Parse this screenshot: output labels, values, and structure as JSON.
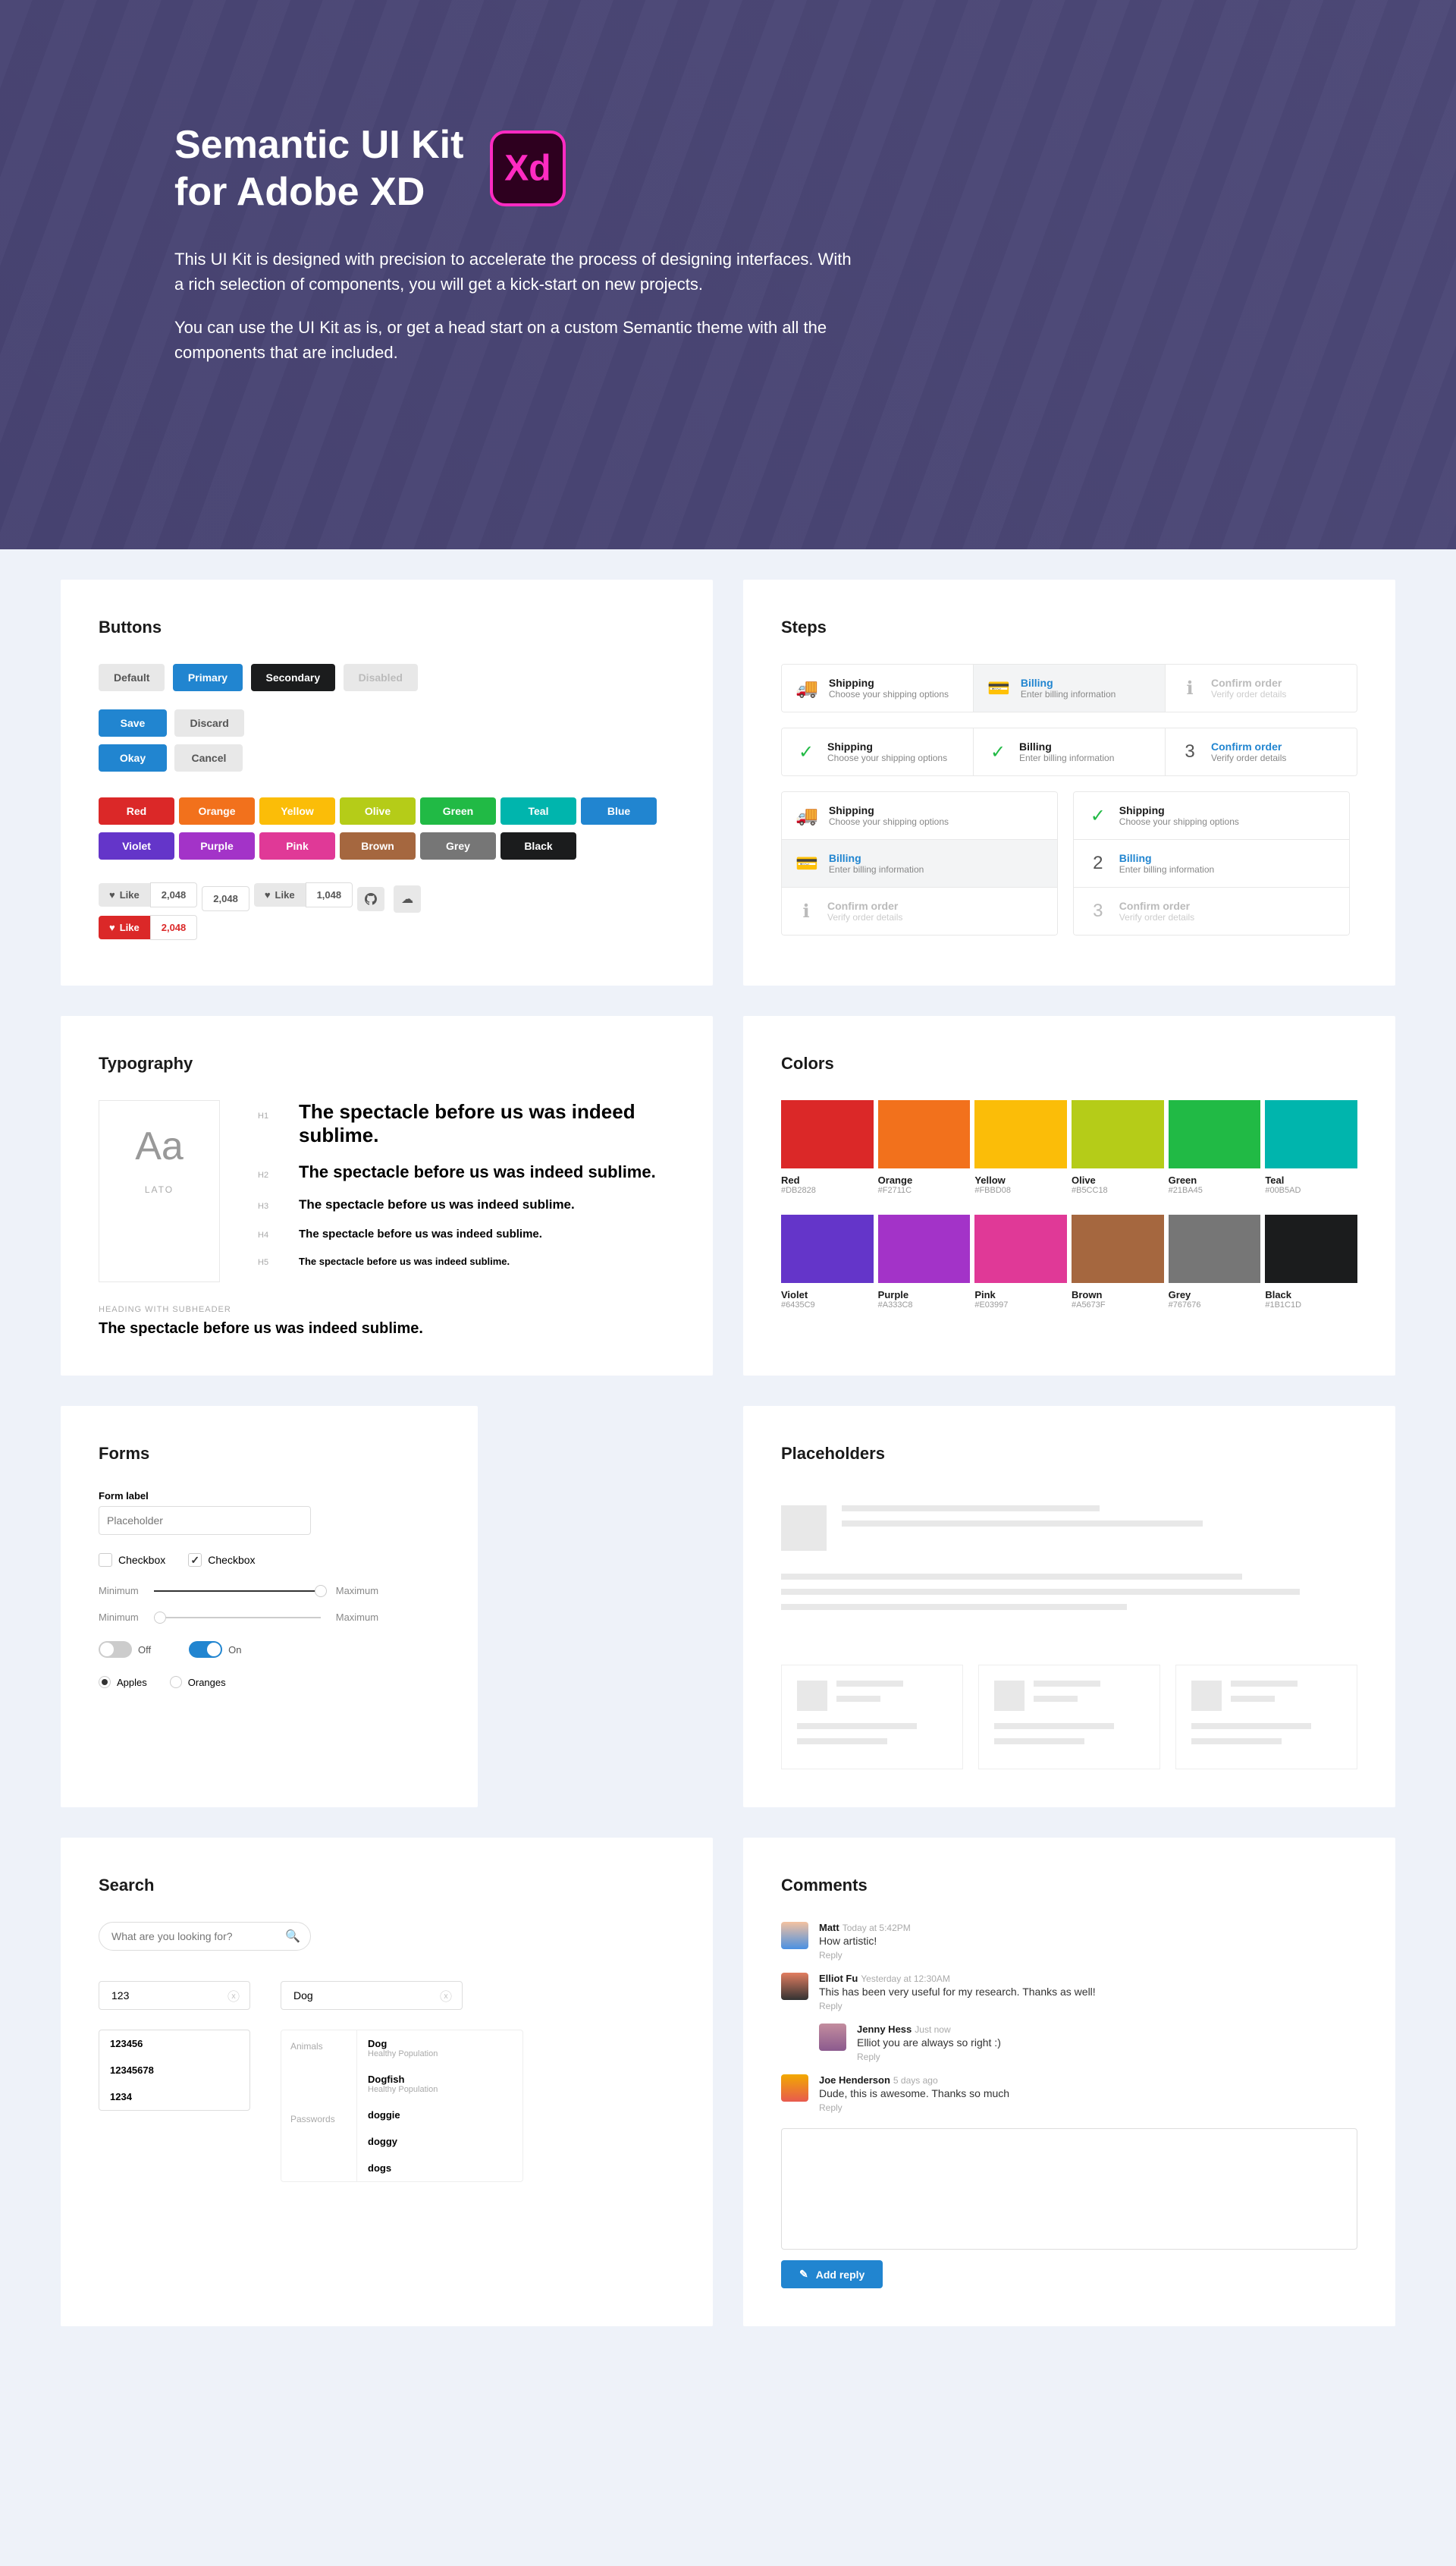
{
  "hero": {
    "title_line1": "Semantic UI Kit",
    "title_line2": "for Adobe XD",
    "para1": "This UI Kit is designed with precision to accelerate the process of designing interfaces. With a rich selection of components, you will get a kick-start on new projects.",
    "para2": "You can use the UI Kit as is, or get a head start on a custom Semantic theme with all the components that are included."
  },
  "sections": {
    "buttons": "Buttons",
    "steps": "Steps",
    "typography": "Typography",
    "colors": "Colors",
    "forms": "Forms",
    "placeholders": "Placeholders",
    "search": "Search",
    "comments": "Comments"
  },
  "buttons": {
    "default": "Default",
    "primary": "Primary",
    "secondary": "Secondary",
    "disabled": "Disabled",
    "save": "Save",
    "discard": "Discard",
    "okay": "Okay",
    "cancel": "Cancel",
    "like": "Like",
    "count": "2,048",
    "count2": "1,048"
  },
  "colorButtons": [
    {
      "name": "Red",
      "hex": "#DB2828"
    },
    {
      "name": "Orange",
      "hex": "#F2711C"
    },
    {
      "name": "Yellow",
      "hex": "#FBBD08"
    },
    {
      "name": "Olive",
      "hex": "#B5CC18"
    },
    {
      "name": "Green",
      "hex": "#21BA45"
    },
    {
      "name": "Teal",
      "hex": "#00B5AD"
    },
    {
      "name": "Blue",
      "hex": "#2185D0"
    },
    {
      "name": "Violet",
      "hex": "#6435C9"
    },
    {
      "name": "Purple",
      "hex": "#A333C8"
    },
    {
      "name": "Pink",
      "hex": "#E03997"
    },
    {
      "name": "Brown",
      "hex": "#A5673F"
    },
    {
      "name": "Grey",
      "hex": "#767676"
    },
    {
      "name": "Black",
      "hex": "#1B1C1D"
    }
  ],
  "steps": {
    "shipping": {
      "title": "Shipping",
      "sub": "Choose your shipping options"
    },
    "billing": {
      "title": "Billing",
      "sub": "Enter billing information"
    },
    "confirm": {
      "title": "Confirm order",
      "sub": "Verify order details"
    }
  },
  "typography": {
    "fontSample": "Aa",
    "fontName": "LATO",
    "sentence": "The spectacle before us was indeed sublime.",
    "labels": {
      "h1": "H1",
      "h2": "H2",
      "h3": "H3",
      "h4": "H4",
      "h5": "H5"
    },
    "subheader": "HEADING WITH SUBHEADER"
  },
  "colors": [
    {
      "name": "Red",
      "hex": "#DB2828"
    },
    {
      "name": "Orange",
      "hex": "#F2711C"
    },
    {
      "name": "Yellow",
      "hex": "#FBBD08"
    },
    {
      "name": "Olive",
      "hex": "#B5CC18"
    },
    {
      "name": "Green",
      "hex": "#21BA45"
    },
    {
      "name": "Teal",
      "hex": "#00B5AD"
    },
    {
      "name": "Violet",
      "hex": "#6435C9"
    },
    {
      "name": "Purple",
      "hex": "#A333C8"
    },
    {
      "name": "Pink",
      "hex": "#E03997"
    },
    {
      "name": "Brown",
      "hex": "#A5673F"
    },
    {
      "name": "Grey",
      "hex": "#767676"
    },
    {
      "name": "Black",
      "hex": "#1B1C1D"
    }
  ],
  "forms": {
    "label": "Form label",
    "placeholder": "Placeholder",
    "checkbox": "Checkbox",
    "minimum": "Minimum",
    "maximum": "Maximum",
    "off": "Off",
    "on": "On",
    "apples": "Apples",
    "oranges": "Oranges"
  },
  "search": {
    "placeholder": "What are you looking for?",
    "val1": "123",
    "items1": [
      "123456",
      "12345678",
      "1234"
    ],
    "val2": "Dog",
    "cat1": "Animals",
    "cat2": "Passwords",
    "animals": [
      {
        "t": "Dog",
        "s": "Healthy Population"
      },
      {
        "t": "Dogfish",
        "s": "Healthy Population"
      }
    ],
    "passwords": [
      "doggie",
      "doggy",
      "dogs"
    ]
  },
  "comments": {
    "list": [
      {
        "name": "Matt",
        "time": "Today at 5:42PM",
        "text": "How artistic!",
        "reply": "Reply",
        "av": "av-matt",
        "nested": false
      },
      {
        "name": "Elliot Fu",
        "time": "Yesterday at 12:30AM",
        "text": "This has been very useful for my research. Thanks as well!",
        "reply": "Reply",
        "av": "av-elliot",
        "nested": false
      },
      {
        "name": "Jenny Hess",
        "time": "Just now",
        "text": "Elliot you are always so right :)",
        "reply": "Reply",
        "av": "av-jenny",
        "nested": true
      },
      {
        "name": "Joe Henderson",
        "time": "5 days ago",
        "text": "Dude, this is awesome. Thanks so much",
        "reply": "Reply",
        "av": "av-joe",
        "nested": false
      }
    ],
    "addReply": "Add reply"
  }
}
